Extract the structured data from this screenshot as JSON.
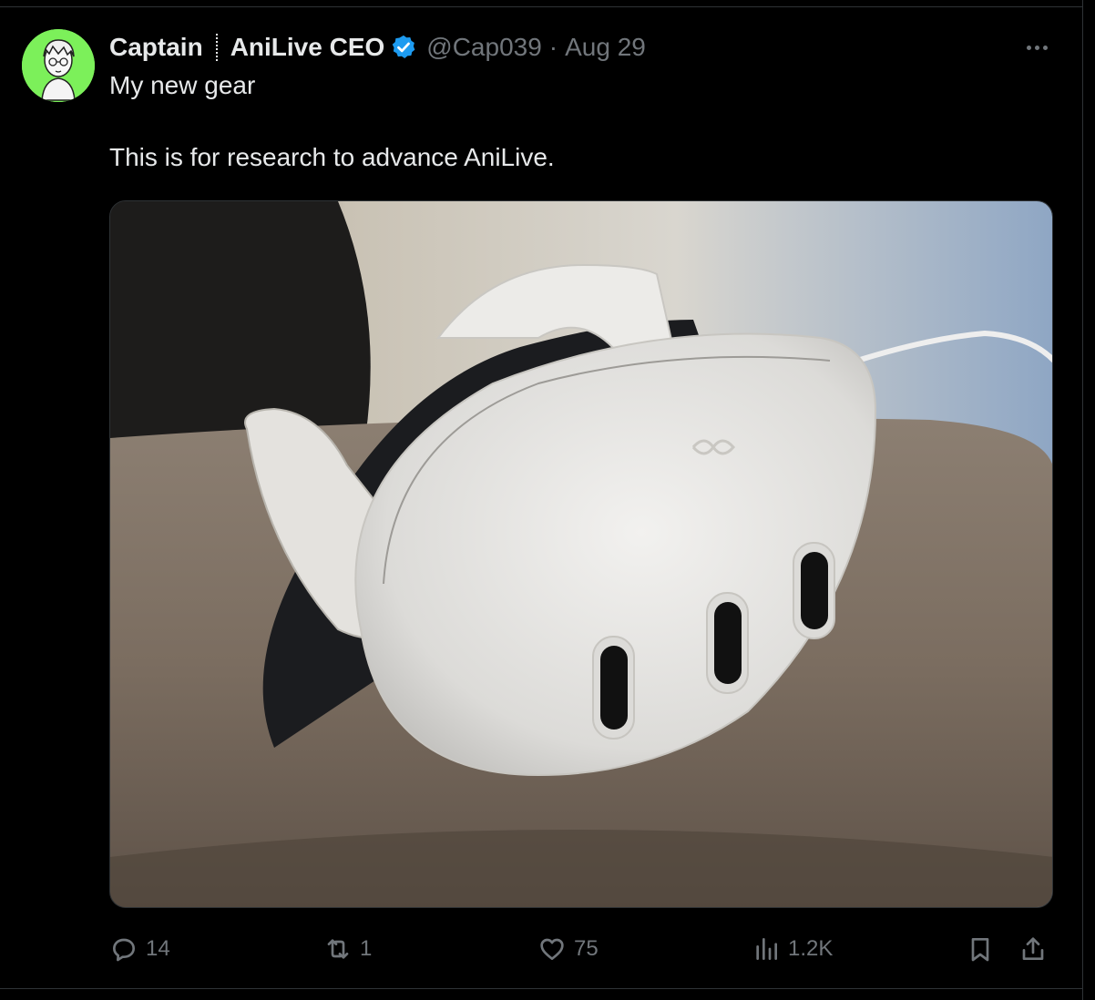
{
  "tweet": {
    "author_name": "Captain",
    "author_affiliation": "AniLive CEO",
    "handle": "@Cap039",
    "separator": "·",
    "date": "Aug 29",
    "text_line1": "My new gear",
    "text_line2": "This is for research to advance AniLive.",
    "verified": true
  },
  "actions": {
    "replies": "14",
    "retweets": "1",
    "likes": "75",
    "views": "1.2K"
  },
  "icons": {
    "more": "more-horizontal-icon",
    "reply": "reply-icon",
    "retweet": "retweet-icon",
    "like": "heart-icon",
    "views": "views-bar-icon",
    "bookmark": "bookmark-icon",
    "share": "share-icon",
    "verified": "verified-badge-icon"
  },
  "colors": {
    "background": "#000000",
    "text": "#e7e9ea",
    "muted": "#71767b",
    "verified": "#1d9bf0",
    "avatar_bg": "#7cf05a"
  }
}
